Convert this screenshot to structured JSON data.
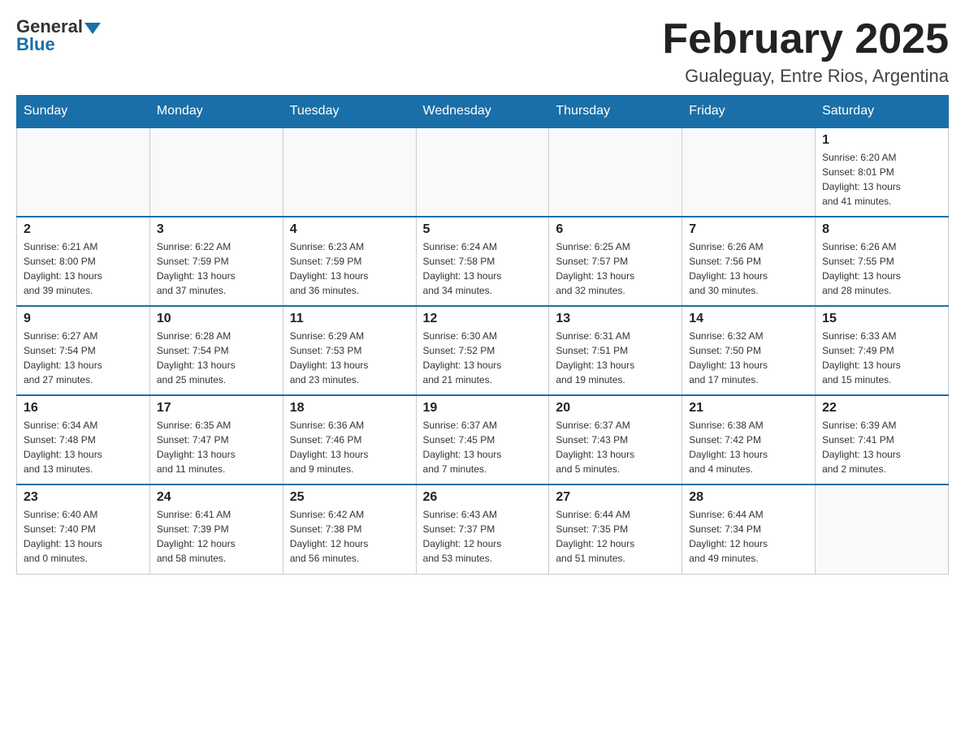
{
  "header": {
    "logo_general": "General",
    "logo_blue": "Blue",
    "month_title": "February 2025",
    "location": "Gualeguay, Entre Rios, Argentina"
  },
  "weekdays": [
    "Sunday",
    "Monday",
    "Tuesday",
    "Wednesday",
    "Thursday",
    "Friday",
    "Saturday"
  ],
  "weeks": [
    [
      {
        "day": "",
        "info": ""
      },
      {
        "day": "",
        "info": ""
      },
      {
        "day": "",
        "info": ""
      },
      {
        "day": "",
        "info": ""
      },
      {
        "day": "",
        "info": ""
      },
      {
        "day": "",
        "info": ""
      },
      {
        "day": "1",
        "info": "Sunrise: 6:20 AM\nSunset: 8:01 PM\nDaylight: 13 hours\nand 41 minutes."
      }
    ],
    [
      {
        "day": "2",
        "info": "Sunrise: 6:21 AM\nSunset: 8:00 PM\nDaylight: 13 hours\nand 39 minutes."
      },
      {
        "day": "3",
        "info": "Sunrise: 6:22 AM\nSunset: 7:59 PM\nDaylight: 13 hours\nand 37 minutes."
      },
      {
        "day": "4",
        "info": "Sunrise: 6:23 AM\nSunset: 7:59 PM\nDaylight: 13 hours\nand 36 minutes."
      },
      {
        "day": "5",
        "info": "Sunrise: 6:24 AM\nSunset: 7:58 PM\nDaylight: 13 hours\nand 34 minutes."
      },
      {
        "day": "6",
        "info": "Sunrise: 6:25 AM\nSunset: 7:57 PM\nDaylight: 13 hours\nand 32 minutes."
      },
      {
        "day": "7",
        "info": "Sunrise: 6:26 AM\nSunset: 7:56 PM\nDaylight: 13 hours\nand 30 minutes."
      },
      {
        "day": "8",
        "info": "Sunrise: 6:26 AM\nSunset: 7:55 PM\nDaylight: 13 hours\nand 28 minutes."
      }
    ],
    [
      {
        "day": "9",
        "info": "Sunrise: 6:27 AM\nSunset: 7:54 PM\nDaylight: 13 hours\nand 27 minutes."
      },
      {
        "day": "10",
        "info": "Sunrise: 6:28 AM\nSunset: 7:54 PM\nDaylight: 13 hours\nand 25 minutes."
      },
      {
        "day": "11",
        "info": "Sunrise: 6:29 AM\nSunset: 7:53 PM\nDaylight: 13 hours\nand 23 minutes."
      },
      {
        "day": "12",
        "info": "Sunrise: 6:30 AM\nSunset: 7:52 PM\nDaylight: 13 hours\nand 21 minutes."
      },
      {
        "day": "13",
        "info": "Sunrise: 6:31 AM\nSunset: 7:51 PM\nDaylight: 13 hours\nand 19 minutes."
      },
      {
        "day": "14",
        "info": "Sunrise: 6:32 AM\nSunset: 7:50 PM\nDaylight: 13 hours\nand 17 minutes."
      },
      {
        "day": "15",
        "info": "Sunrise: 6:33 AM\nSunset: 7:49 PM\nDaylight: 13 hours\nand 15 minutes."
      }
    ],
    [
      {
        "day": "16",
        "info": "Sunrise: 6:34 AM\nSunset: 7:48 PM\nDaylight: 13 hours\nand 13 minutes."
      },
      {
        "day": "17",
        "info": "Sunrise: 6:35 AM\nSunset: 7:47 PM\nDaylight: 13 hours\nand 11 minutes."
      },
      {
        "day": "18",
        "info": "Sunrise: 6:36 AM\nSunset: 7:46 PM\nDaylight: 13 hours\nand 9 minutes."
      },
      {
        "day": "19",
        "info": "Sunrise: 6:37 AM\nSunset: 7:45 PM\nDaylight: 13 hours\nand 7 minutes."
      },
      {
        "day": "20",
        "info": "Sunrise: 6:37 AM\nSunset: 7:43 PM\nDaylight: 13 hours\nand 5 minutes."
      },
      {
        "day": "21",
        "info": "Sunrise: 6:38 AM\nSunset: 7:42 PM\nDaylight: 13 hours\nand 4 minutes."
      },
      {
        "day": "22",
        "info": "Sunrise: 6:39 AM\nSunset: 7:41 PM\nDaylight: 13 hours\nand 2 minutes."
      }
    ],
    [
      {
        "day": "23",
        "info": "Sunrise: 6:40 AM\nSunset: 7:40 PM\nDaylight: 13 hours\nand 0 minutes."
      },
      {
        "day": "24",
        "info": "Sunrise: 6:41 AM\nSunset: 7:39 PM\nDaylight: 12 hours\nand 58 minutes."
      },
      {
        "day": "25",
        "info": "Sunrise: 6:42 AM\nSunset: 7:38 PM\nDaylight: 12 hours\nand 56 minutes."
      },
      {
        "day": "26",
        "info": "Sunrise: 6:43 AM\nSunset: 7:37 PM\nDaylight: 12 hours\nand 53 minutes."
      },
      {
        "day": "27",
        "info": "Sunrise: 6:44 AM\nSunset: 7:35 PM\nDaylight: 12 hours\nand 51 minutes."
      },
      {
        "day": "28",
        "info": "Sunrise: 6:44 AM\nSunset: 7:34 PM\nDaylight: 12 hours\nand 49 minutes."
      },
      {
        "day": "",
        "info": ""
      }
    ]
  ]
}
